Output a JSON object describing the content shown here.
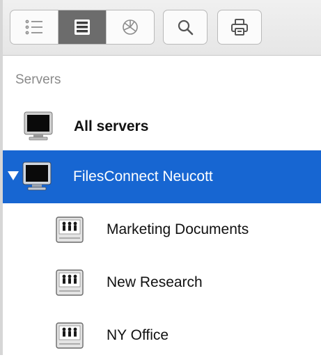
{
  "toolbar": {
    "view_buttons": [
      {
        "icon": "list-view-icon",
        "active": false
      },
      {
        "icon": "server-view-icon",
        "active": true
      },
      {
        "icon": "network-view-icon",
        "active": false
      }
    ],
    "search_icon": "search-icon",
    "print_icon": "print-icon"
  },
  "sidebar": {
    "section_header": "Servers",
    "items": [
      {
        "label": "All servers",
        "icon": "monitor-icon",
        "bold": true
      },
      {
        "label": "FilesConnect Neucott",
        "icon": "monitor-icon",
        "selected": true,
        "expanded": true,
        "children": [
          {
            "label": "Marketing Documents",
            "icon": "shared-volume-icon"
          },
          {
            "label": "New Research",
            "icon": "shared-volume-icon"
          },
          {
            "label": "NY Office",
            "icon": "shared-volume-icon"
          }
        ]
      }
    ]
  },
  "colors": {
    "selection": "#1766d2",
    "section_header": "#8a8a8a",
    "toolbar_bg": "#ececec"
  }
}
